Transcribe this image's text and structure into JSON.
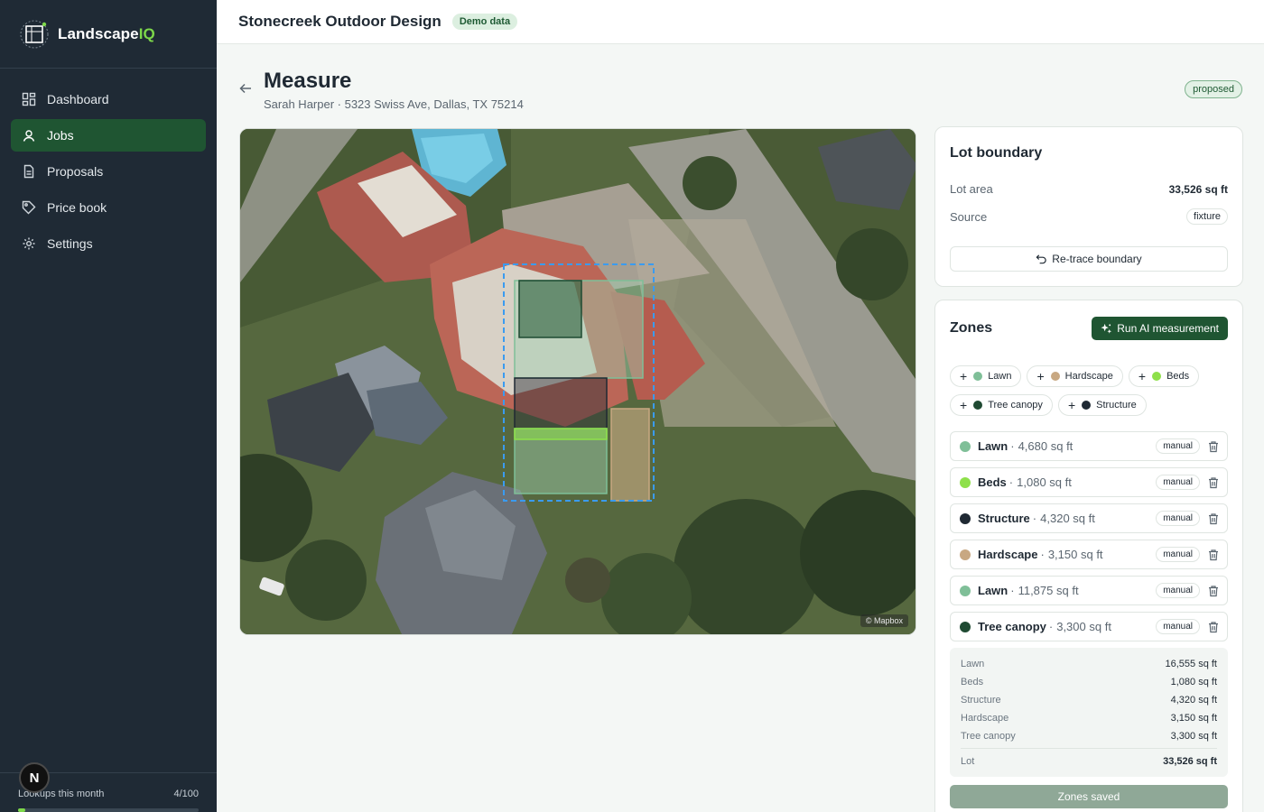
{
  "brand": {
    "name_main": "Landscape",
    "name_accent": "IQ"
  },
  "sidebar": {
    "items": [
      {
        "label": "Dashboard",
        "icon": "dashboard-icon"
      },
      {
        "label": "Jobs",
        "icon": "user-pin-icon",
        "active": true
      },
      {
        "label": "Proposals",
        "icon": "document-icon"
      },
      {
        "label": "Price book",
        "icon": "tag-icon"
      },
      {
        "label": "Settings",
        "icon": "gear-icon"
      }
    ],
    "usage_label": "Lookups this month",
    "usage_value": "4/100",
    "usage_fraction": 0.04,
    "dev_badge": "N"
  },
  "topbar": {
    "company": "Stonecreek Outdoor Design",
    "badge": "Demo data"
  },
  "page": {
    "title": "Measure",
    "subtitle": "Sarah Harper · 5323 Swiss Ave, Dallas, TX 75214",
    "status": "proposed"
  },
  "map": {
    "attribution": "© Mapbox"
  },
  "lot": {
    "title": "Lot boundary",
    "area_label": "Lot area",
    "area_value": "33,526 sq ft",
    "source_label": "Source",
    "source_value": "fixture",
    "retrace_label": "Re-trace boundary"
  },
  "zones": {
    "title": "Zones",
    "run_label": "Run AI measurement",
    "chips": [
      {
        "label": "Lawn",
        "color": "#7fbf98"
      },
      {
        "label": "Hardscape",
        "color": "#c8a882"
      },
      {
        "label": "Beds",
        "color": "#8ee04a"
      },
      {
        "label": "Tree canopy",
        "color": "#1f4a32"
      },
      {
        "label": "Structure",
        "color": "#1f2933"
      }
    ],
    "rows": [
      {
        "name": "Lawn",
        "area": "4,680 sq ft",
        "tag": "manual",
        "color": "#7fbf98"
      },
      {
        "name": "Beds",
        "area": "1,080 sq ft",
        "tag": "manual",
        "color": "#8ee04a"
      },
      {
        "name": "Structure",
        "area": "4,320 sq ft",
        "tag": "manual",
        "color": "#1f2933"
      },
      {
        "name": "Hardscape",
        "area": "3,150 sq ft",
        "tag": "manual",
        "color": "#c8a882"
      },
      {
        "name": "Lawn",
        "area": "11,875 sq ft",
        "tag": "manual",
        "color": "#7fbf98"
      },
      {
        "name": "Tree canopy",
        "area": "3,300 sq ft",
        "tag": "manual",
        "color": "#1f4a32"
      }
    ],
    "summary": [
      {
        "label": "Lawn",
        "value": "16,555 sq ft"
      },
      {
        "label": "Beds",
        "value": "1,080 sq ft"
      },
      {
        "label": "Structure",
        "value": "4,320 sq ft"
      },
      {
        "label": "Hardscape",
        "value": "3,150 sq ft"
      },
      {
        "label": "Tree canopy",
        "value": "3,300 sq ft"
      }
    ],
    "total_label": "Lot",
    "total_value": "33,526 sq ft",
    "saved_label": "Zones saved"
  }
}
